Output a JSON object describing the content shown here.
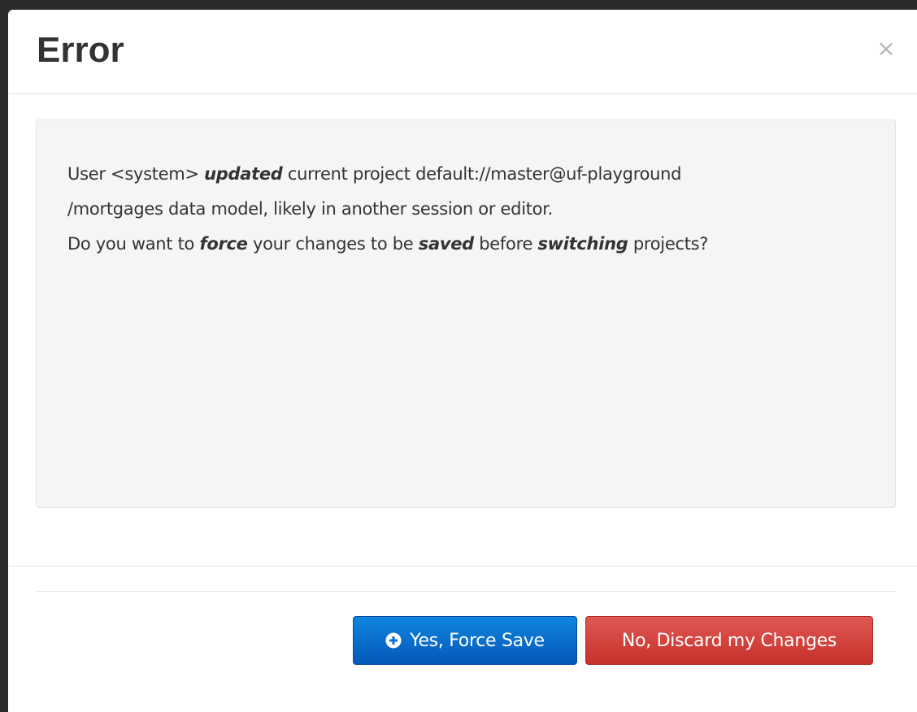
{
  "dialog": {
    "title": "Error",
    "close_label": "×"
  },
  "message": {
    "line1_user": "User <system> ",
    "line1_action": "updated",
    "line1_rest": " current project default://master@uf-playground",
    "line2": "/mortgages data model, likely in another session or editor.",
    "line3_a": "Do you want to ",
    "line3_force": "force",
    "line3_b": " your changes to be ",
    "line3_saved": "saved",
    "line3_c": " before ",
    "line3_switching": "switching",
    "line3_d": " projects?"
  },
  "footer": {
    "force_save_label": "Yes, Force Save",
    "force_save_icon": "plus-circle-icon",
    "discard_label": "No, Discard my Changes"
  },
  "colors": {
    "primary": "#0458b8",
    "danger": "#d2322d"
  }
}
